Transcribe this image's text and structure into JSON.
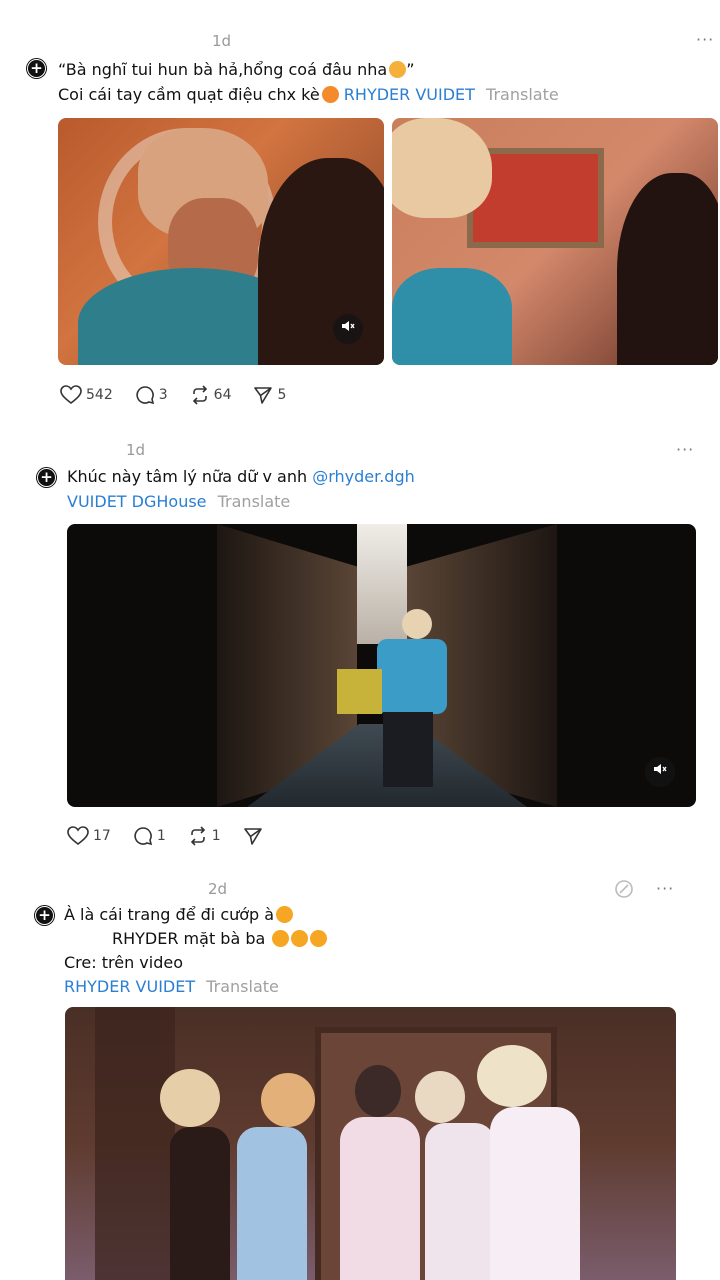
{
  "post1": {
    "time": "1d",
    "line1": "“Bà nghĩ tui hun bà hả,hổng coá đâu nha",
    "line1_end": "”",
    "line2": "Coi cái tay cầm quạt điệu chx kè",
    "tag": "RHYDER VUIDET",
    "translate": "Translate",
    "likes": "542",
    "comments": "3",
    "reposts": "64",
    "shares": "5"
  },
  "post2": {
    "time": "1d",
    "line1": "Khúc này tâm lý nữa dữ v anh",
    "mention": "@rhyder.dgh",
    "tags": "VUIDET DGHouse",
    "translate": "Translate",
    "likes": "17",
    "comments": "1",
    "reposts": "1"
  },
  "post3": {
    "time": "2d",
    "line1": "À là cái trang để đi cướp à",
    "line2": "RHYDER mặt bà ba",
    "line3": "Cre: trên video",
    "tags": "RHYDER VUIDET",
    "translate": "Translate"
  },
  "icons": {
    "more": "more-icon",
    "plus": "follow-plus-icon",
    "mute": "muted-speaker-icon",
    "like": "heart-icon",
    "comment": "comment-icon",
    "repost": "repost-icon",
    "share": "share-icon"
  }
}
